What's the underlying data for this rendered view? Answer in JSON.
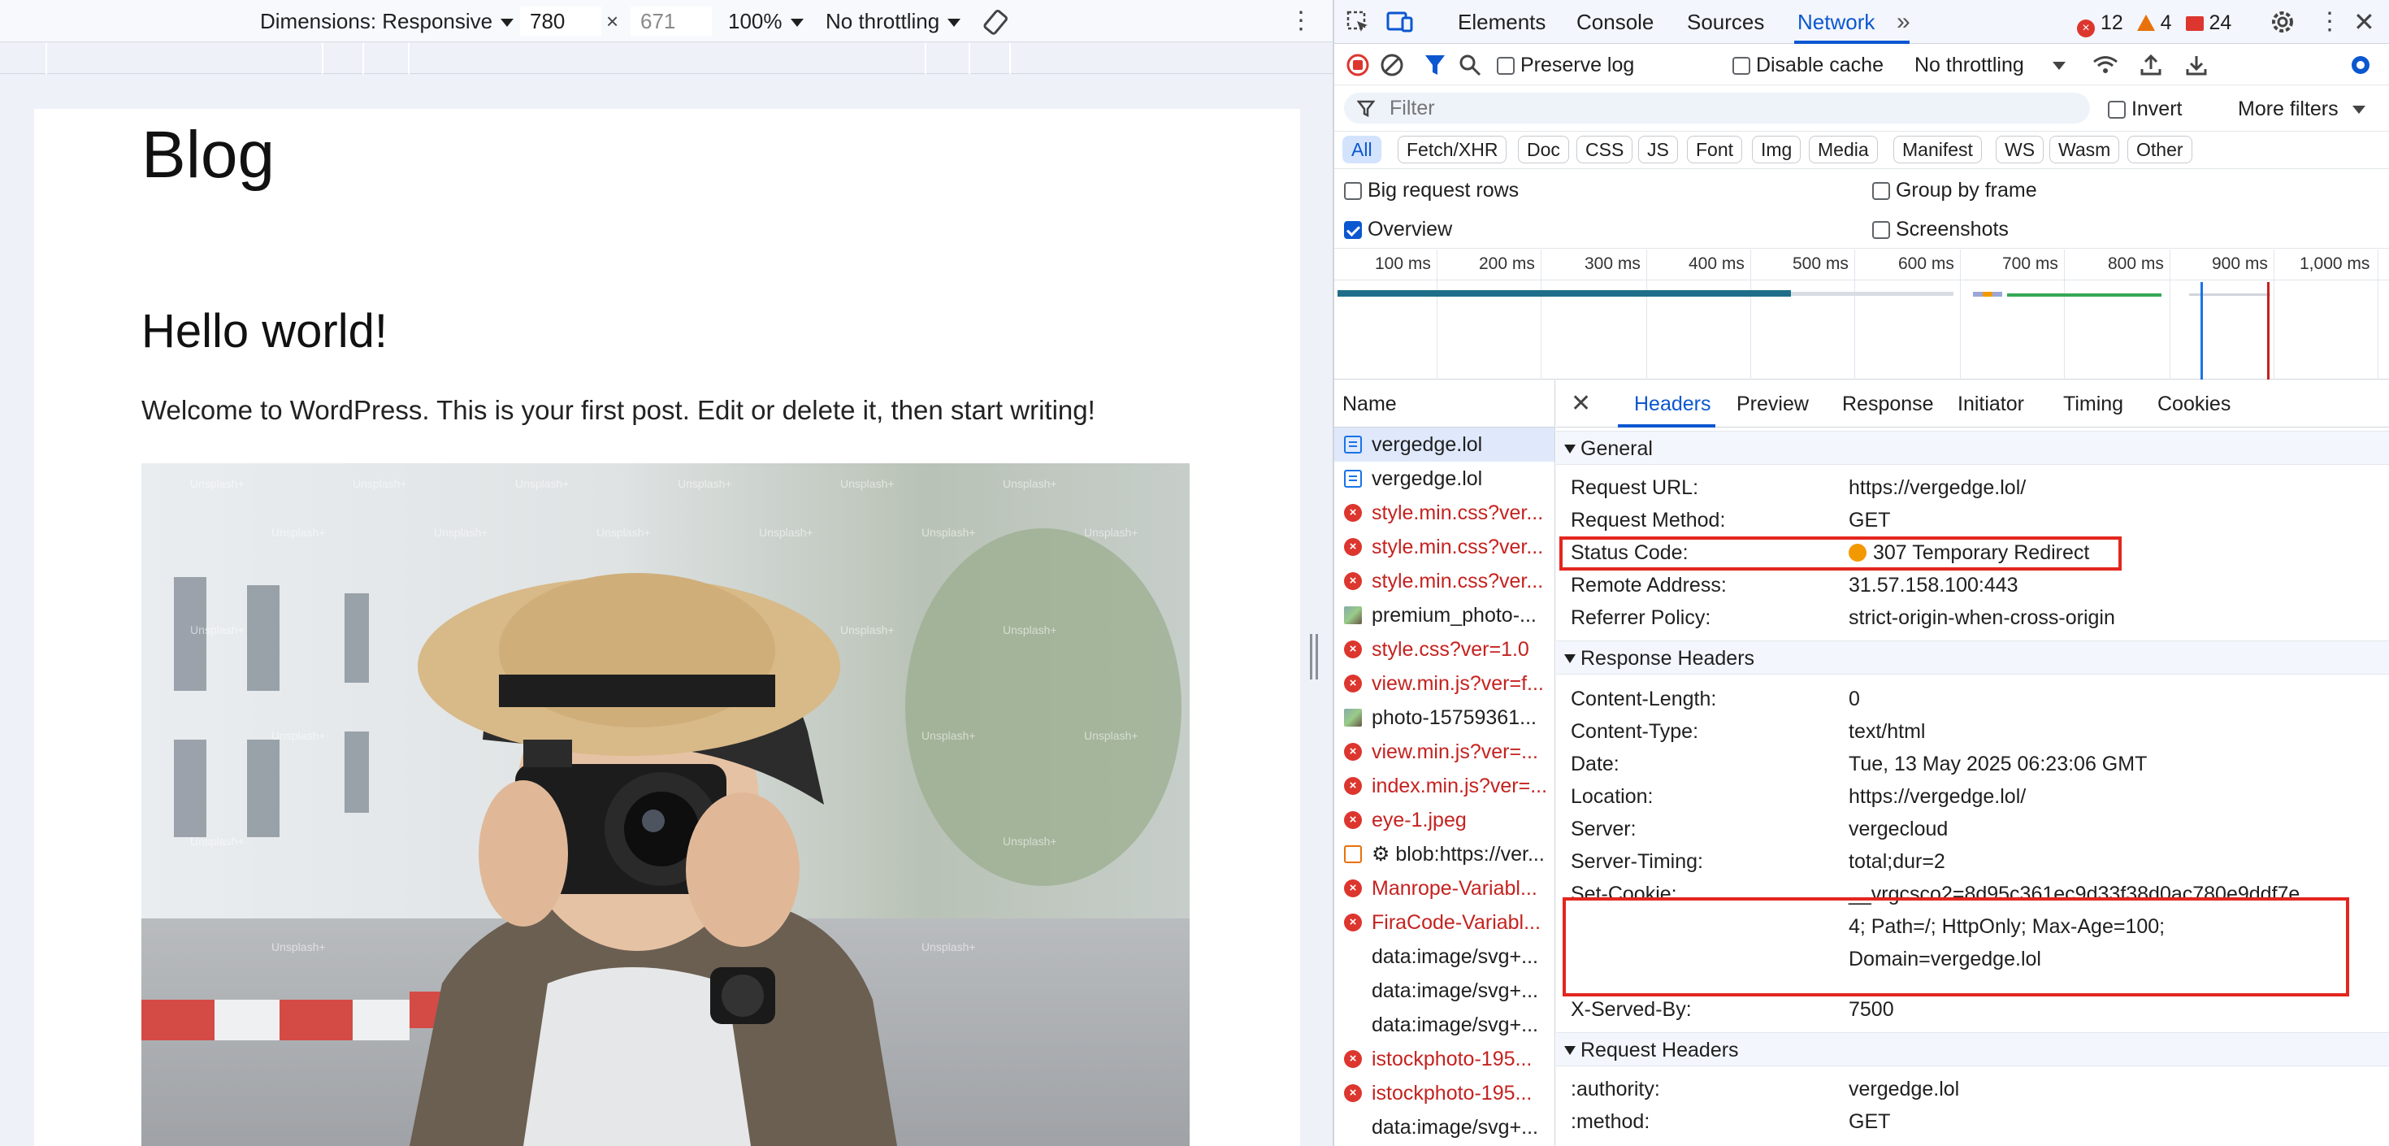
{
  "emulation": {
    "dimensions_label": "Dimensions: Responsive",
    "width": "780",
    "height": "671",
    "zoom": "100%",
    "throttling": "No throttling"
  },
  "page": {
    "blog_title": "Blog",
    "post_title": "Hello world!",
    "post_text": "Welcome to WordPress. This is your first post. Edit or delete it, then start writing!",
    "watermark": "Unsplash+"
  },
  "devtools": {
    "tabs": [
      "Elements",
      "Console",
      "Sources",
      "Network"
    ],
    "active_tab": "Network",
    "errors": "12",
    "warnings": "4",
    "messages": "24",
    "toolbar": {
      "preserve_log": "Preserve log",
      "disable_cache": "Disable cache",
      "throttling": "No throttling"
    },
    "filter": {
      "placeholder": "Filter",
      "invert": "Invert",
      "more_filters": "More filters"
    },
    "types": [
      "All",
      "Fetch/XHR",
      "Doc",
      "CSS",
      "JS",
      "Font",
      "Img",
      "Media",
      "Manifest",
      "WS",
      "Wasm",
      "Other"
    ],
    "options": {
      "big_rows": "Big request rows",
      "group_by_frame": "Group by frame",
      "overview": "Overview",
      "screenshots": "Screenshots"
    },
    "timeline_labels": [
      "100 ms",
      "200 ms",
      "300 ms",
      "400 ms",
      "500 ms",
      "600 ms",
      "700 ms",
      "800 ms",
      "900 ms",
      "1,000 ms"
    ],
    "name_header": "Name",
    "requests": [
      {
        "name": "vergedge.lol",
        "kind": "doc",
        "selected": true
      },
      {
        "name": "vergedge.lol",
        "kind": "doc"
      },
      {
        "name": "style.min.css?ver...",
        "kind": "err"
      },
      {
        "name": "style.min.css?ver...",
        "kind": "err"
      },
      {
        "name": "style.min.css?ver...",
        "kind": "err"
      },
      {
        "name": "premium_photo-...",
        "kind": "img"
      },
      {
        "name": "style.css?ver=1.0",
        "kind": "err"
      },
      {
        "name": "view.min.js?ver=f...",
        "kind": "err"
      },
      {
        "name": "photo-15759361...",
        "kind": "img"
      },
      {
        "name": "view.min.js?ver=...",
        "kind": "err"
      },
      {
        "name": "index.min.js?ver=...",
        "kind": "err"
      },
      {
        "name": "eye-1.jpeg",
        "kind": "err"
      },
      {
        "name": "⚙ blob:https://ver...",
        "kind": "blob"
      },
      {
        "name": "Manrope-Variabl...",
        "kind": "err"
      },
      {
        "name": "FiraCode-Variabl...",
        "kind": "err"
      },
      {
        "name": "data:image/svg+...",
        "kind": "none"
      },
      {
        "name": "data:image/svg+...",
        "kind": "none"
      },
      {
        "name": "data:image/svg+...",
        "kind": "none"
      },
      {
        "name": "istockphoto-195...",
        "kind": "err"
      },
      {
        "name": "istockphoto-195...",
        "kind": "err"
      },
      {
        "name": "data:image/svg+...",
        "kind": "data"
      }
    ],
    "detail_tabs": [
      "Headers",
      "Preview",
      "Response",
      "Initiator",
      "Timing",
      "Cookies"
    ],
    "general": {
      "title": "General",
      "rows": [
        {
          "k": "Request URL:",
          "v": "https://vergedge.lol/"
        },
        {
          "k": "Request Method:",
          "v": "GET"
        },
        {
          "k": "Status Code:",
          "v": "307 Temporary Redirect"
        },
        {
          "k": "Remote Address:",
          "v": "31.57.158.100:443"
        },
        {
          "k": "Referrer Policy:",
          "v": "strict-origin-when-cross-origin"
        }
      ]
    },
    "response_headers": {
      "title": "Response Headers",
      "rows": [
        {
          "k": "Content-Length:",
          "v": "0"
        },
        {
          "k": "Content-Type:",
          "v": "text/html"
        },
        {
          "k": "Date:",
          "v": "Tue, 13 May 2025 06:23:06 GMT"
        },
        {
          "k": "Location:",
          "v": "https://vergedge.lol/"
        },
        {
          "k": "Server:",
          "v": "vergecloud"
        },
        {
          "k": "Server-Timing:",
          "v": "total;dur=2"
        },
        {
          "k": "Set-Cookie:",
          "v_lines": [
            "__vrgcsco2=8d95c361ec9d33f38d0ac780e9ddf7e",
            "4; Path=/; HttpOnly; Max-Age=100;",
            "Domain=vergedge.lol"
          ]
        },
        {
          "k": "X-Served-By:",
          "v": "7500"
        }
      ]
    },
    "request_headers": {
      "title": "Request Headers",
      "rows": [
        {
          "k": ":authority:",
          "v": "vergedge.lol"
        },
        {
          "k": ":method:",
          "v": "GET"
        }
      ]
    },
    "colors": {
      "accent": "#0b57d0",
      "error": "#dc362e",
      "highlight": "#e3261f",
      "status_redirect": "#f29900"
    }
  }
}
